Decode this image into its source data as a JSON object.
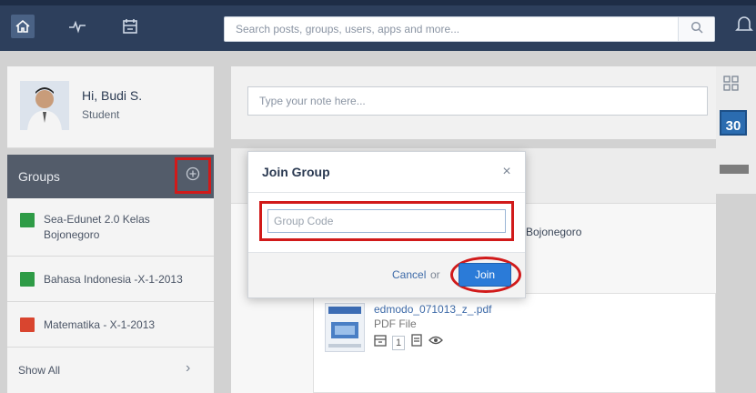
{
  "topbar": {
    "search_placeholder": "Search posts, groups, users, apps and more...",
    "icons": [
      "home-icon",
      "activity-icon",
      "planner-icon",
      "search-icon",
      "notification-icon"
    ]
  },
  "profile": {
    "greeting": "Hi, Budi S.",
    "role": "Student"
  },
  "groups": {
    "title": "Groups",
    "items": [
      {
        "label": "Sea-Edunet 2.0 Kelas Bojonegoro",
        "color": "#2e9b46"
      },
      {
        "label": "Bahasa Indonesia -X-1-2013",
        "color": "#2e9b46"
      },
      {
        "label": "Matematika - X-1-2013",
        "color": "#d9452f"
      }
    ],
    "show_all": "Show All"
  },
  "composer": {
    "placeholder": "Type your note here..."
  },
  "feed": {
    "group_text": "Bojonegoro",
    "attachment": {
      "filename": "edmodo_071013_z_.pdf",
      "filetype": "PDF File",
      "count": "1"
    }
  },
  "rail": {
    "calendar_day": "30"
  },
  "modal": {
    "title": "Join Group",
    "close": "×",
    "code_placeholder": "Group Code",
    "cancel": "Cancel",
    "or": "or",
    "join": "Join"
  },
  "colors": {
    "topbar": "#2d3f5c",
    "accent": "#2b7bd8",
    "highlight": "#d11a1a"
  }
}
